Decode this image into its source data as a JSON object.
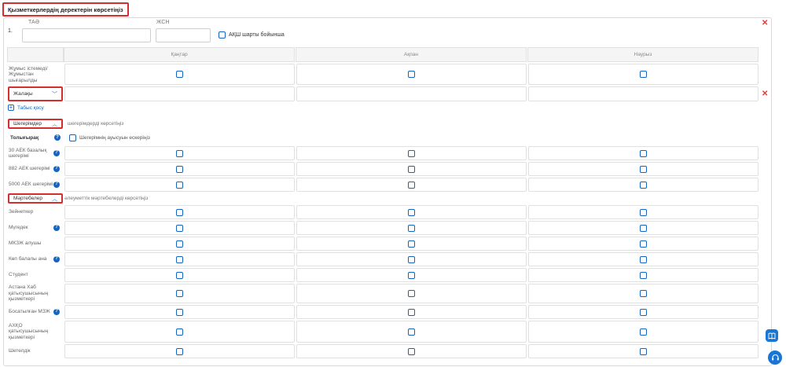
{
  "section_title": "Қызметкерлердің деректерін көрсетіңіз",
  "employee": {
    "number": "1.",
    "tao_label": "ТАӘ",
    "jsn_label": "ЖСН",
    "tao_value": "",
    "jsn_value": "",
    "usa_checkbox_label": "АҚШ шарты бойынша"
  },
  "months": [
    "Қаңтар",
    "Ақпан",
    "Наурыз"
  ],
  "not_working_label": "Жұмыс істемеді/ Жұмыстан шығарылды",
  "income_type": {
    "selected": "Жалақы"
  },
  "add_income_label": "Табыс қосу",
  "deductions": {
    "toggle_label": "Шегерімдер",
    "hint": "шегерімдерді көрсетіңіз",
    "full_label": "Толығырақ",
    "amount_checkbox_label": "Шегерімнің ауысуын ескеріңіз",
    "rows": [
      {
        "label": "30 АЕК базалық шегерімі"
      },
      {
        "label": "882 АЕК шегерімі"
      },
      {
        "label": "5000 АЕК шегерімі"
      }
    ]
  },
  "statuses": {
    "toggle_label": "Мәртебелер",
    "hint": "әлеуметтік мәртебелерді көрсетіңіз",
    "rows": [
      {
        "label": "Зейнеткер"
      },
      {
        "label": "Мүгедек"
      },
      {
        "label": "МКЗЖ алушы"
      },
      {
        "label": "Көп балалы ана"
      },
      {
        "label": "Студент"
      },
      {
        "label": "Астана Хаб қатысушысының қызметкері"
      },
      {
        "label": "Босатылған МЗЖ"
      },
      {
        "label": "АХҚО қатысушысының қызметкері"
      },
      {
        "label": "Шетелдік"
      }
    ]
  }
}
